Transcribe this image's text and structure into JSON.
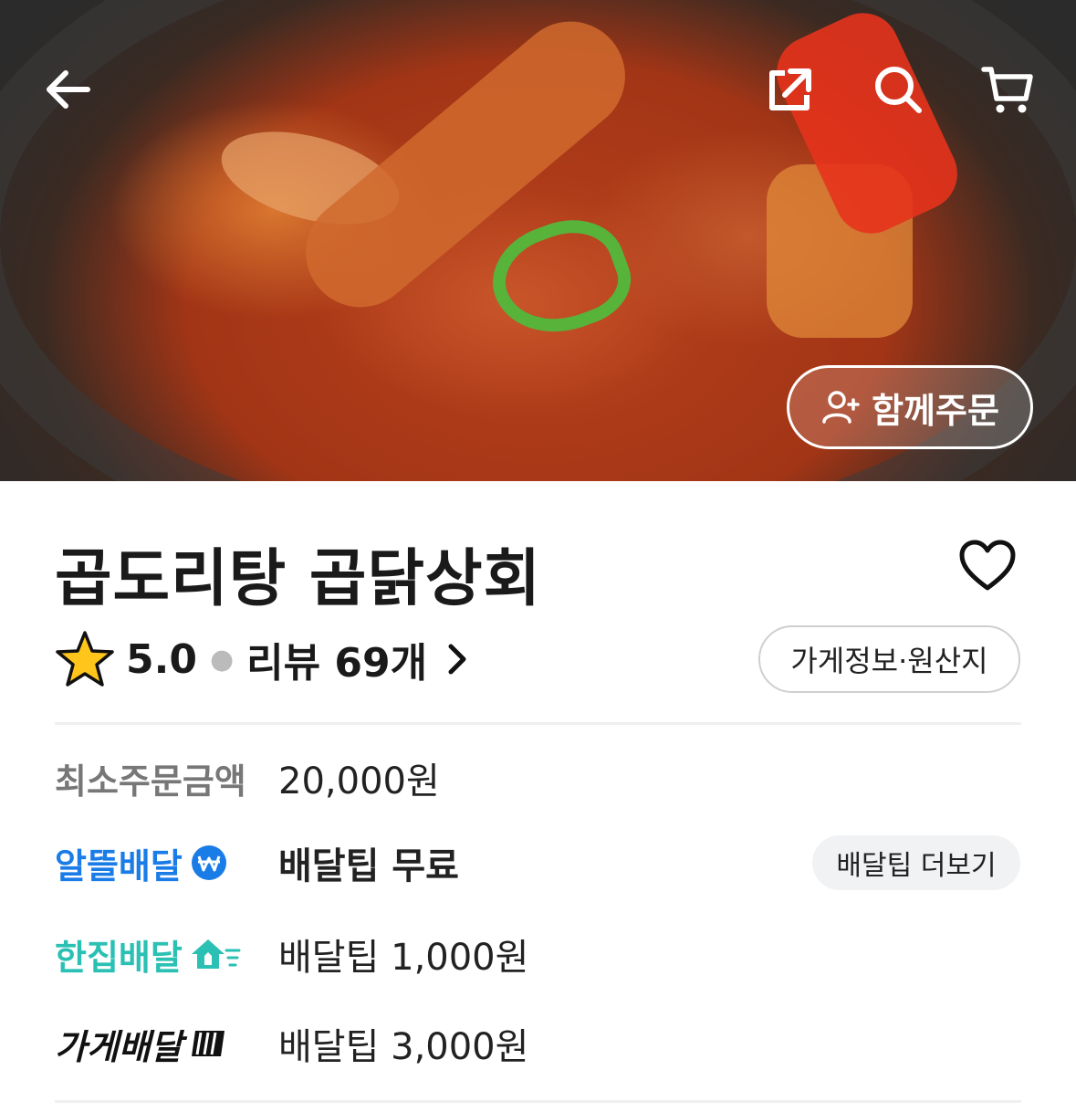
{
  "header": {
    "back_icon": "arrow-left-icon",
    "share_icon": "share-icon",
    "search_icon": "search-icon",
    "cart_icon": "cart-icon",
    "group_order_label": "함께주문"
  },
  "store": {
    "name": "곱도리탕 곱닭상회",
    "rating": "5.0",
    "review_text": "리뷰 69개",
    "info_button_label": "가게정보·원산지"
  },
  "details": {
    "min_order_label": "최소주문금액",
    "min_order_value": "20,000원",
    "delivery_options": [
      {
        "label": "알뜰배달",
        "value": "배달팁 무료",
        "color": "#1a7ce6",
        "icon": "won-coin-icon"
      },
      {
        "label": "한집배달",
        "value": "배달팁 1,000원",
        "color": "#2bc0b4",
        "icon": "fast-house-icon"
      },
      {
        "label": "가게배달",
        "value": "배달팁 3,000원",
        "color": "#111111",
        "icon": "delivery-bars-icon"
      }
    ],
    "more_tips_label": "배달팁 더보기"
  },
  "colors": {
    "accent_blue": "#1a7ce6",
    "accent_teal": "#2bc0b4",
    "star": "#ffc51a"
  }
}
